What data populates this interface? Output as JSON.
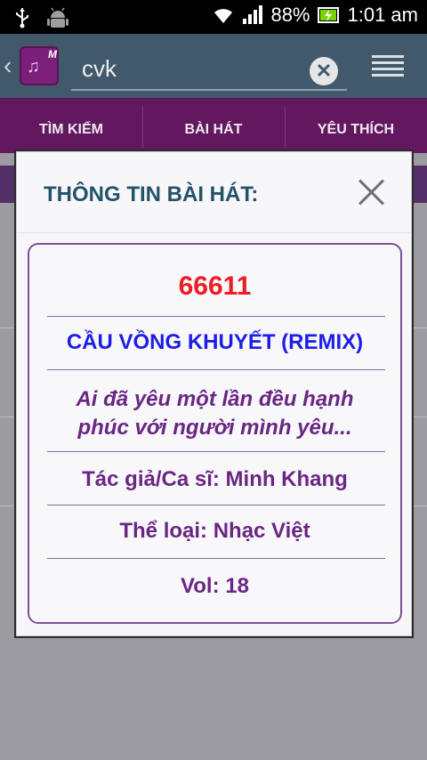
{
  "status_bar": {
    "battery_percent": "88%",
    "time": "1:01 am",
    "icons": [
      "usb-icon",
      "android-icon",
      "wifi-icon",
      "signal-icon",
      "battery-charging-icon"
    ]
  },
  "action_bar": {
    "search_value": "cvk",
    "icons": [
      "back-chevron-icon",
      "app-logo-icon",
      "clear-search-icon",
      "menu-icon"
    ]
  },
  "tabs": [
    {
      "label": "TÌM KIẾM"
    },
    {
      "label": "BÀI HÁT"
    },
    {
      "label": "YÊU THÍCH"
    }
  ],
  "dialog": {
    "title": "THÔNG TIN BÀI HÁT:",
    "song_code": "66611",
    "song_name": "CẦU VỒNG KHUYẾT (REMIX)",
    "lyric_line_1": "Ai đã yêu một lần đều hạnh",
    "lyric_line_2": "phúc với người mình yêu...",
    "author": "Tác giả/Ca sĩ: Minh Khang",
    "genre": "Thể loại: Nhạc Việt",
    "volume": "Vol: 18"
  },
  "colors": {
    "action_bar": "#41596a",
    "tab_bar": "#61185f",
    "song_code": "#ee1c24",
    "song_name": "#1d1de6",
    "info_text": "#6a2683",
    "dialog_title": "#24526a"
  }
}
